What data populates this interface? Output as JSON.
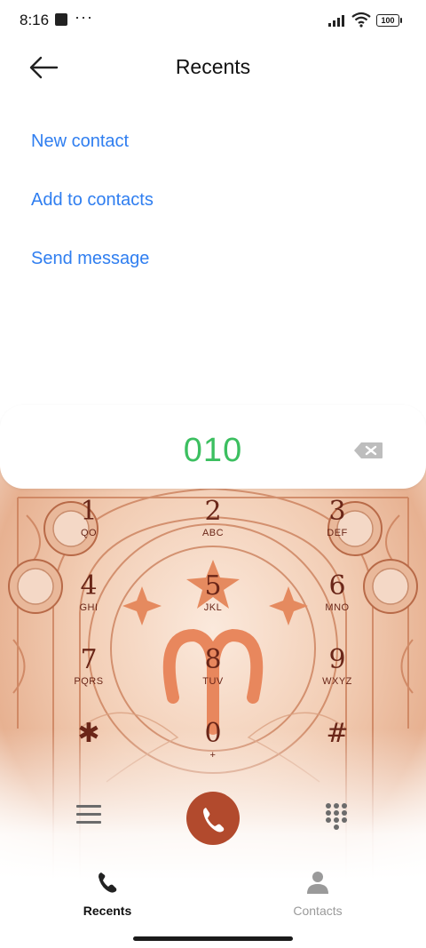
{
  "status_bar": {
    "time": "8:16",
    "dots": "···",
    "battery": "100"
  },
  "header": {
    "title": "Recents"
  },
  "actions": [
    {
      "label": "New contact"
    },
    {
      "label": "Add to contacts"
    },
    {
      "label": "Send message"
    }
  ],
  "dialer": {
    "number": "010",
    "keys": [
      {
        "digit": "1",
        "letters": "QO"
      },
      {
        "digit": "2",
        "letters": "ABC"
      },
      {
        "digit": "3",
        "letters": "DEF"
      },
      {
        "digit": "4",
        "letters": "GHI"
      },
      {
        "digit": "5",
        "letters": "JKL"
      },
      {
        "digit": "6",
        "letters": "MNO"
      },
      {
        "digit": "7",
        "letters": "PQRS"
      },
      {
        "digit": "8",
        "letters": "TUV"
      },
      {
        "digit": "9",
        "letters": "WXYZ"
      },
      {
        "digit": "✱",
        "letters": ""
      },
      {
        "digit": "0",
        "letters": "+"
      },
      {
        "digit": "#",
        "letters": ""
      }
    ]
  },
  "bottom_nav": [
    {
      "label": "Recents",
      "icon": "phone-icon",
      "active": true
    },
    {
      "label": "Contacts",
      "icon": "person-icon",
      "active": false
    }
  ],
  "colors": {
    "accent_link": "#2f7ef0",
    "number": "#3cbf60",
    "call_button": "#b24a2d",
    "keypad_text": "#6a2618"
  }
}
